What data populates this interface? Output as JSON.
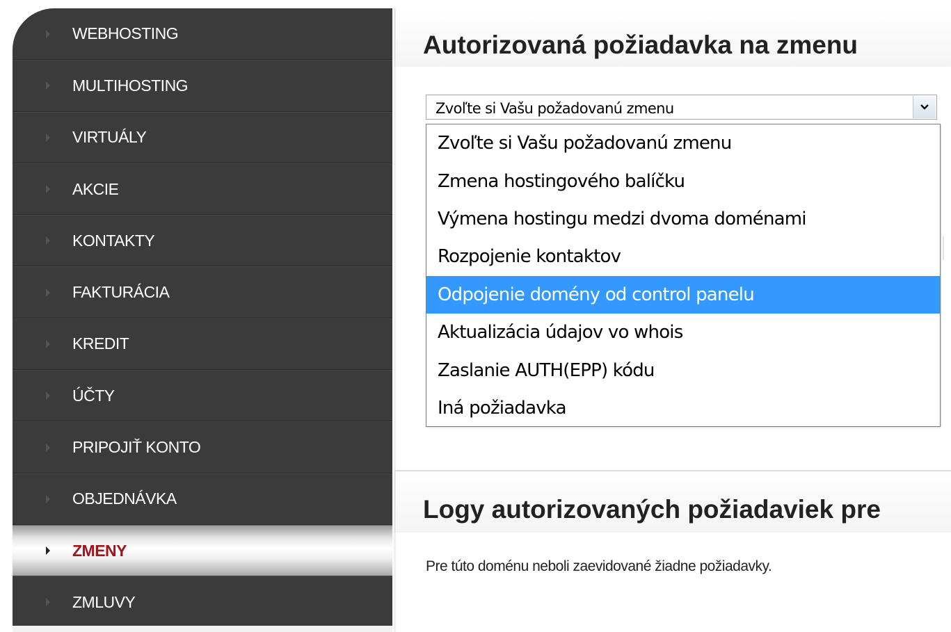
{
  "sidebar": {
    "items": [
      {
        "label": "WEBHOSTING",
        "active": false
      },
      {
        "label": "MULTIHOSTING",
        "active": false
      },
      {
        "label": "VIRTUÁLY",
        "active": false
      },
      {
        "label": "AKCIE",
        "active": false
      },
      {
        "label": "KONTAKTY",
        "active": false
      },
      {
        "label": "FAKTURÁCIA",
        "active": false
      },
      {
        "label": "KREDIT",
        "active": false
      },
      {
        "label": "ÚČTY",
        "active": false
      },
      {
        "label": "PRIPOJIŤ KONTO",
        "active": false
      },
      {
        "label": "OBJEDNÁVKA",
        "active": false
      },
      {
        "label": "ZMENY",
        "active": true
      },
      {
        "label": "ZMLUVY",
        "active": false
      }
    ]
  },
  "main": {
    "title": "Autorizovaná požiadavka na zmenu",
    "select": {
      "value": "Zvoľte si Vašu požadovanú zmenu",
      "options": [
        "Zvoľte si Vašu požadovanú zmenu",
        "Zmena hostingového balíčku",
        "Výmena hostingu medzi dvoma doménami",
        "Rozpojenie kontaktov",
        "Odpojenie domény od control panelu",
        "Aktualizácia údajov vo whois",
        "Zaslanie AUTH(EPP) kódu",
        "Iná požiadavka"
      ],
      "highlighted_option": "Odpojenie domény od control panelu"
    },
    "logs_title": "Logy autorizovaných požiadaviek pre",
    "logs_text": "Pre túto doménu neboli zaevidované žiadne požiadavky."
  },
  "colors": {
    "sidebar_bg": "#3b3b3b",
    "active_label": "#a0141e",
    "highlight": "#3399ff"
  }
}
